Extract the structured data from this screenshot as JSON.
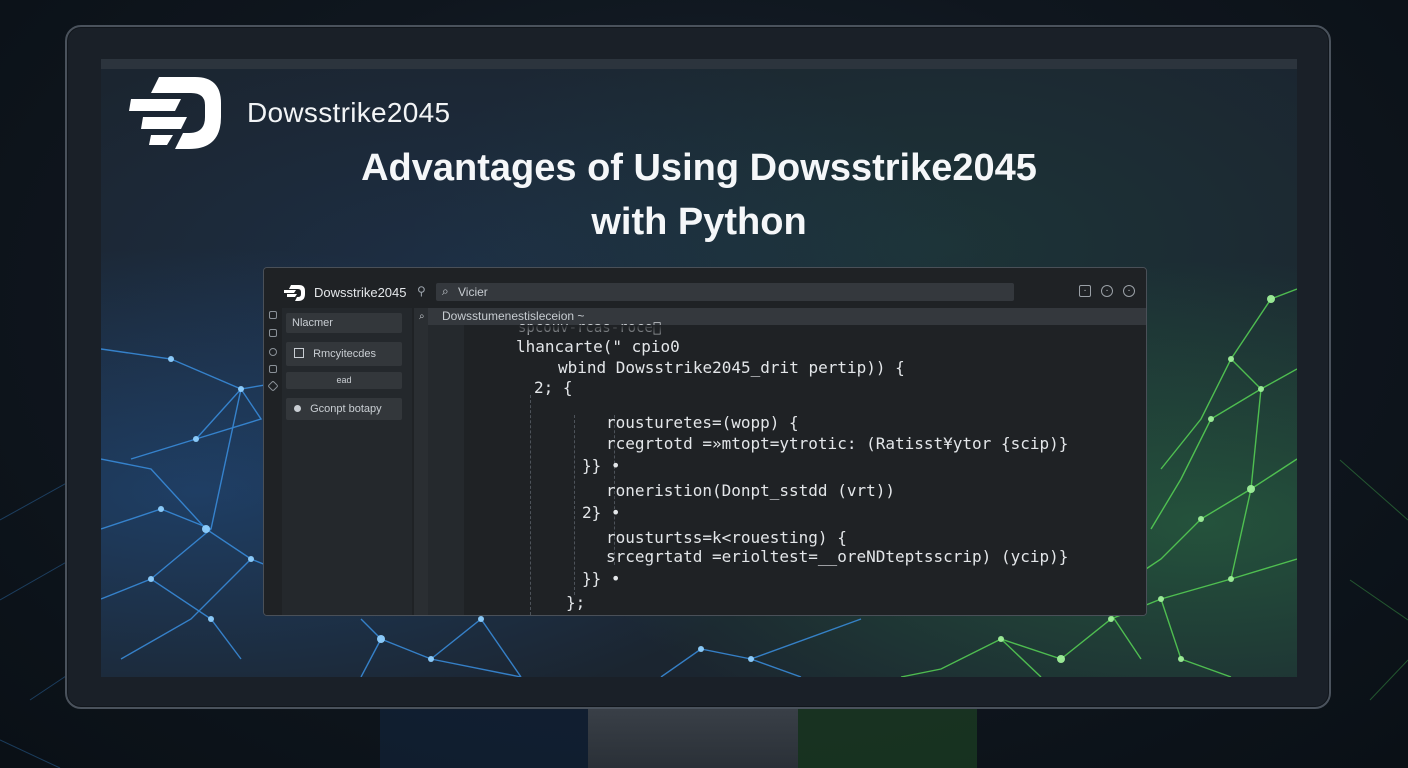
{
  "brand": {
    "name": "Dowsstrike2045"
  },
  "headline": {
    "line1": "Advantages of Using Dowsstrike2045",
    "line2": "with Python"
  },
  "ide": {
    "app_name": "Dowsstrike2045",
    "search": {
      "value": "Vicier",
      "icon": "search-icon"
    },
    "window_icons": [
      "square-icon",
      "gear-icon",
      "clock-icon"
    ],
    "sidebar": {
      "items": [
        {
          "label": "Nlacmer"
        },
        {
          "label": "Rmcyitecdes",
          "icon": "tile-icon"
        },
        {
          "label": "ead"
        },
        {
          "label": "Gconpt botapy",
          "icon": "circle-icon"
        }
      ]
    },
    "tab": {
      "label": "Dowsstumenestisleceion ~"
    },
    "code": [
      "spcouv-rcas-roce\u0000",
      "lhancarte(\" cpio0",
      "wbind Dowsstrike2045_drit pertip)) {",
      "2; {",
      "rousturetes=(wopp) {",
      "rcegrtotd =»mtopt=ytrotic: (Ratisst¥ytor {scip)}",
      "}} •",
      "roneristion(Donpt_sstdd (vrt))",
      "2} •",
      "rousturtss=k<rouesting) {",
      "srcegrtatd =erioltest=__oreNDteptsscrip) (ycip)}",
      "}} •",
      "};"
    ]
  },
  "colors": {
    "background": "#0f161e",
    "screen": "#1b2530",
    "network_blue": "#3a8fe0",
    "network_green": "#5fdc5a",
    "ide_bg": "#1f2225"
  }
}
